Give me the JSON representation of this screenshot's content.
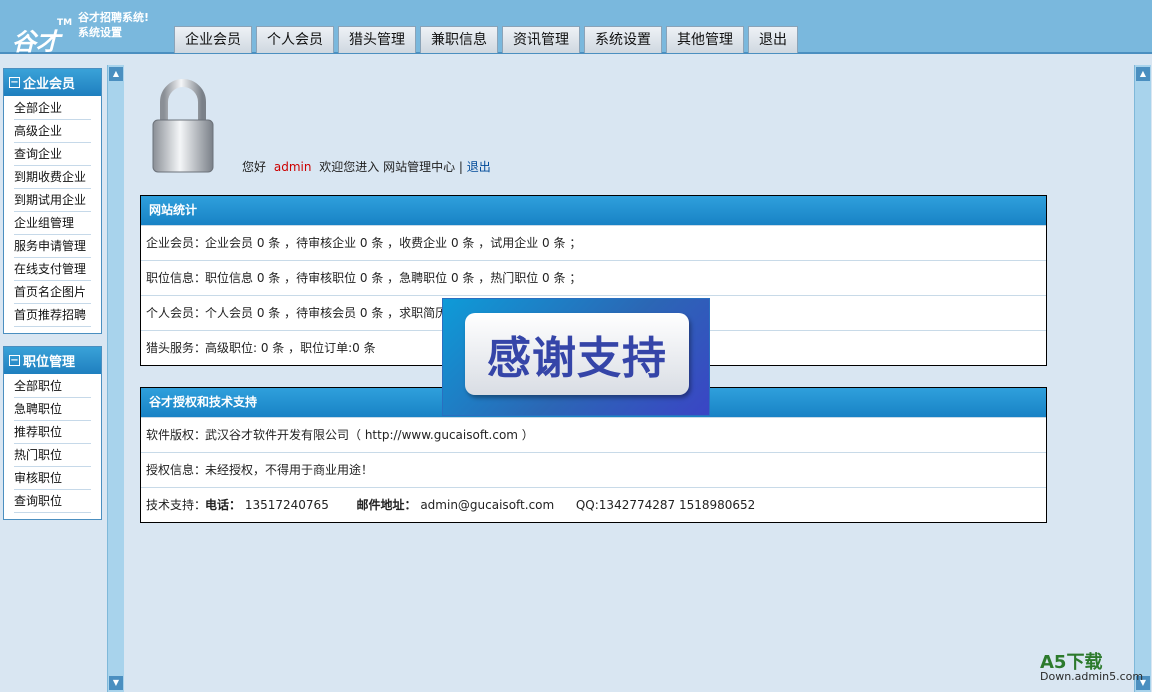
{
  "header": {
    "logo_text": "谷才",
    "logo_tm": "TM",
    "brand_line1": "谷才招聘系统!",
    "brand_line2": "系统设置",
    "tabs": [
      "企业会员",
      "个人会员",
      "猎头管理",
      "兼职信息",
      "资讯管理",
      "系统设置",
      "其他管理",
      "退出"
    ]
  },
  "sidebar": {
    "groups": [
      {
        "title": "企业会员",
        "items": [
          "全部企业",
          "高级企业",
          "查询企业",
          "到期收费企业",
          "到期试用企业",
          "企业组管理",
          "服务申请管理",
          "在线支付管理",
          "首页名企图片",
          "首页推荐招聘"
        ]
      },
      {
        "title": "职位管理",
        "items": [
          "全部职位",
          "急聘职位",
          "推荐职位",
          "热门职位",
          "审核职位",
          "查询职位"
        ]
      }
    ]
  },
  "welcome": {
    "hello": "您好",
    "user": "admin",
    "text": "欢迎您进入  网站管理中心  |",
    "logout": "退出"
  },
  "stats": {
    "title": "网站统计",
    "rows": [
      {
        "label": "企业会员：",
        "value": "企业会员  0 条 ，待审核企业  0 条 ，收费企业  0 条 ，试用企业  0 条 ；"
      },
      {
        "label": "职位信息：",
        "value": "职位信息  0 条 ，待审核职位  0 条 ，急聘职位  0 条 ，热门职位  0 条 ；"
      },
      {
        "label": "个人会员：",
        "value": "个人会员  0 条 ，待审核会员  0 条 ，求职简历"
      },
      {
        "label": "猎头服务：",
        "value": "高级职位: 0 条 ，职位订单:0 条"
      }
    ]
  },
  "license": {
    "title": "谷才授权和技术支持",
    "copyright_label": "软件版权：",
    "copyright_value": "武汉谷才软件开发有限公司（ http://www.gucaisoft.com ）",
    "auth_label": "授权信息：",
    "auth_value": "未经授权，不得用于商业用途！",
    "support_label": "技术支持：",
    "phone_label": "电话：",
    "phone": "13517240765",
    "email_label": "邮件地址：",
    "email": "admin@gucaisoft.com",
    "qq": "QQ:1342774287  1518980652"
  },
  "popup": {
    "text": "感谢支持"
  },
  "watermark": {
    "line1": "A5下载",
    "line2": "Down.admin5.com"
  },
  "colors": {
    "header": "#7ab8dd",
    "panel_title": "#1882c5",
    "user": "#cc0000"
  }
}
